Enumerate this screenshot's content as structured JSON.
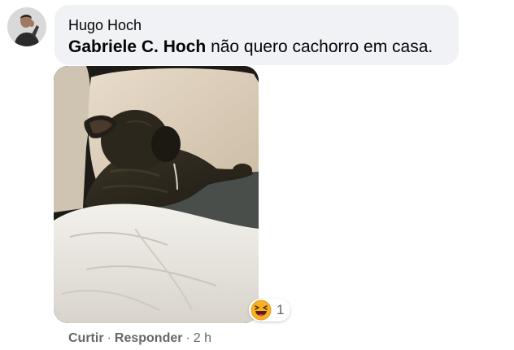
{
  "comment": {
    "author": "Hugo Hoch",
    "mention": "Gabriele C. Hoch",
    "message": "não quero cachorro em casa."
  },
  "reaction": {
    "icon": "haha-emoji-icon",
    "count": "1"
  },
  "actions": {
    "like_label": "Curtir",
    "reply_label": "Responder",
    "separator": "·",
    "timestamp": "2 h"
  },
  "colors": {
    "bubble_bg": "#f0f2f5",
    "text_primary": "#050505",
    "text_secondary": "#65676b",
    "reaction_yellow": "#f7b125"
  }
}
